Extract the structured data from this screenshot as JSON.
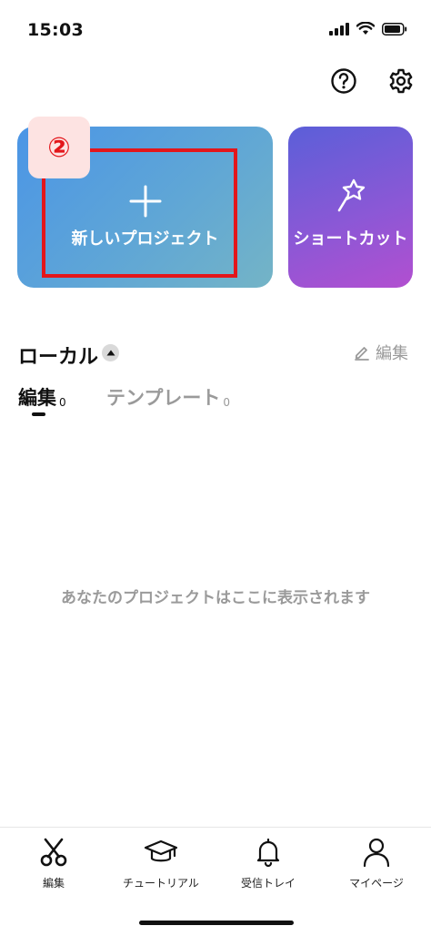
{
  "status_bar": {
    "time": "15:03"
  },
  "cards": {
    "new_project": {
      "label": "新しいプロジェクト"
    },
    "shortcut": {
      "label": "ショートカット"
    }
  },
  "annotation": {
    "step": "②",
    "color": "#e3161b"
  },
  "section": {
    "title": "ローカル",
    "edit_label": "編集",
    "tabs": [
      {
        "label": "編集",
        "count": "0",
        "selected": true
      },
      {
        "label": "テンプレート",
        "count": "0",
        "selected": false
      }
    ],
    "empty_message": "あなたのプロジェクトはここに表示されます"
  },
  "bottom_nav": {
    "items": [
      {
        "label": "編集",
        "icon": "scissors-icon"
      },
      {
        "label": "チュートリアル",
        "icon": "graduation-cap-icon"
      },
      {
        "label": "受信トレイ",
        "icon": "bell-icon"
      },
      {
        "label": "マイページ",
        "icon": "person-icon"
      }
    ]
  },
  "colors": {
    "new_project_gradient": [
      "#4b95e6",
      "#74b4c6"
    ],
    "shortcut_gradient": [
      "#5b5fd8",
      "#b24fd0"
    ],
    "muted_text": "#9a9a9a"
  }
}
